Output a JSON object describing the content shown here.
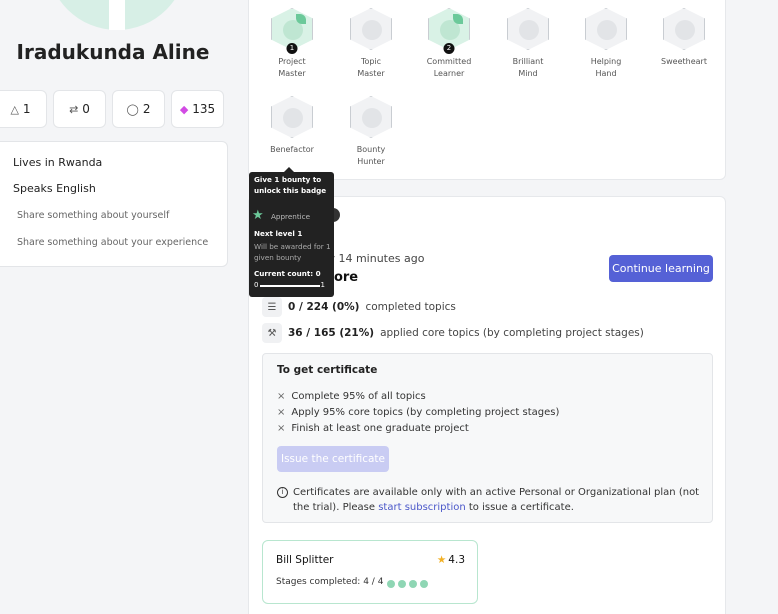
{
  "profile": {
    "name": "Iradukunda Aline",
    "stats": [
      {
        "icon": "graduation-icon",
        "value": "1"
      },
      {
        "icon": "route-icon",
        "value": "0"
      },
      {
        "icon": "shield-icon",
        "value": "2"
      },
      {
        "icon": "gem-icon",
        "value": "135"
      }
    ],
    "about": {
      "lives_in": "Lives in Rwanda",
      "speaks": "Speaks English",
      "share_about": "Share something about yourself",
      "share_experience": "Share something about your experience"
    }
  },
  "badges": [
    {
      "name_line1": "Project",
      "name_line2": "Master",
      "level": "1",
      "earned": true
    },
    {
      "name_line1": "Topic",
      "name_line2": "Master",
      "level": "",
      "earned": false
    },
    {
      "name_line1": "Committed",
      "name_line2": "Learner",
      "level": "2",
      "earned": true
    },
    {
      "name_line1": "Brilliant",
      "name_line2": "Mind",
      "level": "",
      "earned": false
    },
    {
      "name_line1": "Helping",
      "name_line2": "Hand",
      "level": "",
      "earned": false
    },
    {
      "name_line1": "Sweetheart",
      "name_line2": "",
      "level": "",
      "earned": false
    },
    {
      "name_line1": "Benefactor",
      "name_line2": "",
      "level": "",
      "earned": false
    },
    {
      "name_line1": "Bounty",
      "name_line2": "Hunter",
      "level": "",
      "earned": false
    }
  ],
  "tooltip": {
    "head_line1": "Give 1 bounty to",
    "head_line2": "unlock this badge",
    "badge_name": "Apprentice",
    "next_level": "Next level 1",
    "sub_line1": "Will be awarded for 1",
    "sub_line2": "given bounty",
    "current_count": "Current count: 0",
    "min": "0",
    "max": "1"
  },
  "course": {
    "last_activity": "Last activity 14 minutes ago",
    "title": "Python Core",
    "continue_label": "Continue learning",
    "completed": {
      "value": "0 / 224 (0%)",
      "text": "completed topics"
    },
    "applied": {
      "value": "36 / 165 (21%)",
      "text": "applied core topics (by completing project stages)"
    }
  },
  "certificate": {
    "title": "To get certificate",
    "requirements": [
      "Complete 95% of all topics",
      "Apply 95% core topics (by completing project stages)",
      "Finish at least one graduate project"
    ],
    "issue_label": "Issue the certificate",
    "note_before": "Certificates are available only with an active Personal or Organizational plan (not the trial). Please",
    "note_link": "start subscription",
    "note_after": "to issue a certificate."
  },
  "project": {
    "name": "Bill Splitter",
    "rating": "4.3",
    "stages_label": "Stages completed:",
    "stages_value": "4 / 4",
    "stages_done": 4
  }
}
